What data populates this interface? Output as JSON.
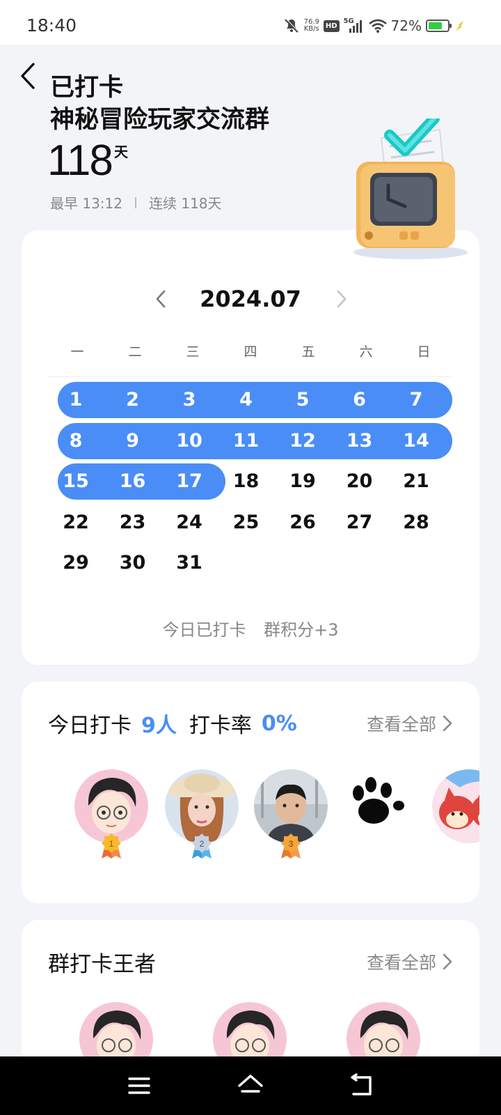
{
  "status_bar": {
    "time": "18:40",
    "net_speed_value": "76.9",
    "net_speed_unit": "KB/s",
    "hd_label": "HD",
    "network_label": "5G",
    "battery_percent": "72%",
    "battery_level": 0.72,
    "icons": [
      "mute-bell-icon",
      "hd-icon",
      "signal-icon",
      "wifi-icon",
      "battery-icon",
      "charging-icon"
    ]
  },
  "header": {
    "title": "已打卡",
    "group_name": "神秘冒险玩家交流群",
    "days": "118",
    "days_unit": "天",
    "earliest": "最早 13:12",
    "streak": "连续 118天"
  },
  "calendar": {
    "month": "2024.07",
    "weekdays": [
      "一",
      "二",
      "三",
      "四",
      "五",
      "六",
      "日"
    ],
    "rows": [
      [
        "1",
        "2",
        "3",
        "4",
        "5",
        "6",
        "7"
      ],
      [
        "8",
        "9",
        "10",
        "11",
        "12",
        "13",
        "14"
      ],
      [
        "15",
        "16",
        "17",
        "18",
        "19",
        "20",
        "21"
      ],
      [
        "22",
        "23",
        "24",
        "25",
        "26",
        "27",
        "28"
      ],
      [
        "29",
        "30",
        "31"
      ]
    ],
    "checked_days": 17,
    "status_left": "今日已打卡",
    "status_right": "群积分+3",
    "accent": "#4a8df6"
  },
  "today": {
    "label": "今日打卡",
    "count": "9人",
    "rate_label": "打卡率",
    "rate": "0%",
    "view_all": "查看全部",
    "medals": [
      "1",
      "2",
      "3"
    ]
  },
  "kings": {
    "title": "群打卡王者",
    "view_all": "查看全部"
  }
}
